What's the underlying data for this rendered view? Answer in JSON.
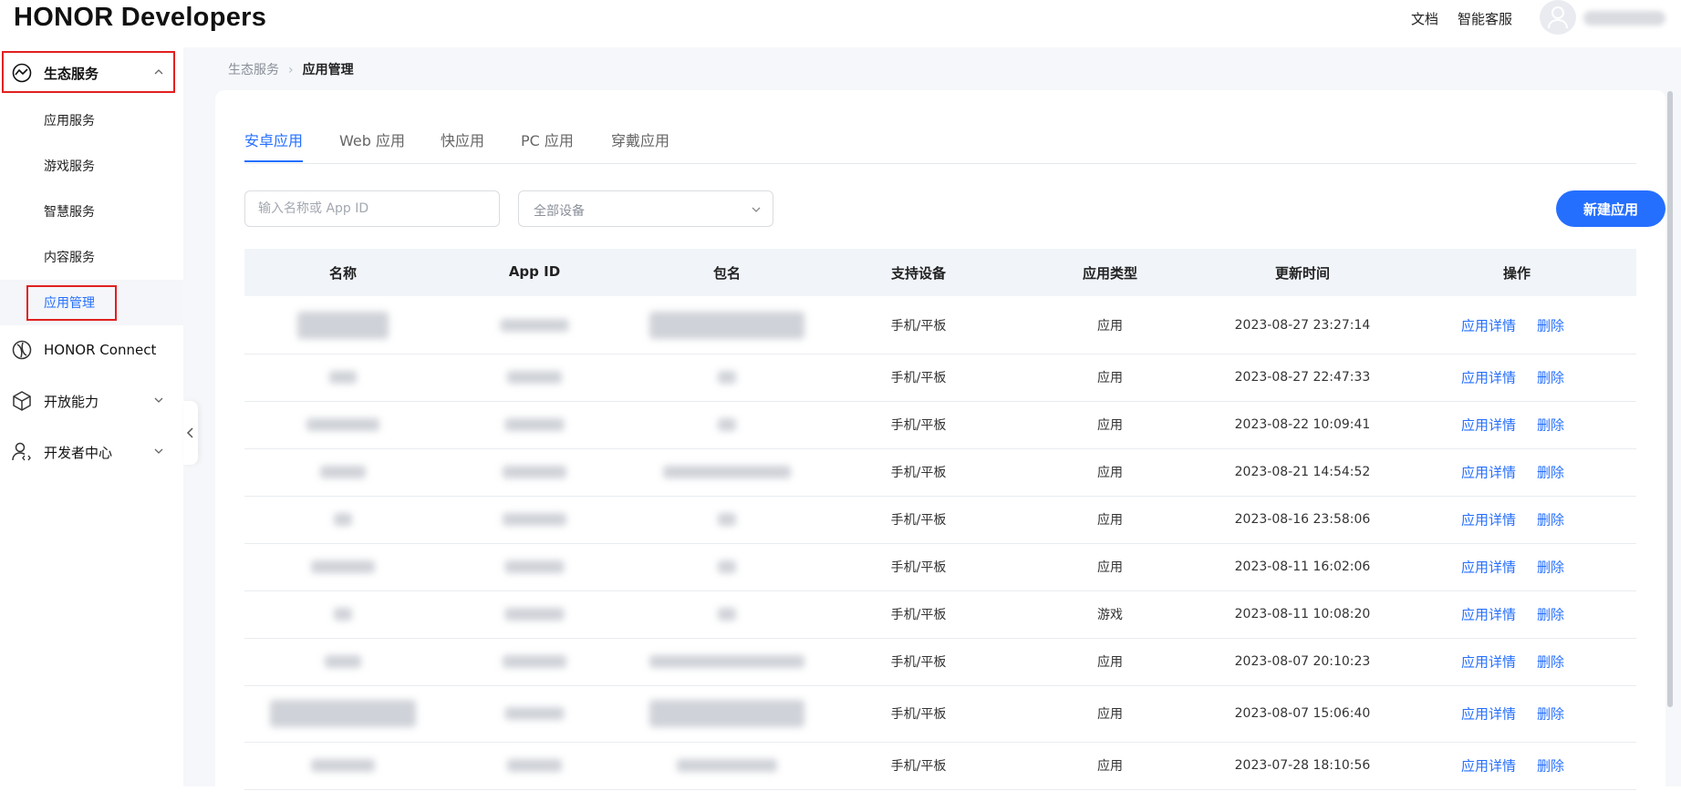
{
  "header": {
    "logo": "HONOR Developers",
    "docs": "文档",
    "support": "智能客服"
  },
  "sidebar": {
    "groups": [
      {
        "label": "生态服务",
        "icon": "ecosystem-icon",
        "expanded": true
      },
      {
        "label": "HONOR Connect",
        "icon": "connect-icon"
      },
      {
        "label": "开放能力",
        "icon": "cube-icon"
      },
      {
        "label": "开发者中心",
        "icon": "developer-icon"
      }
    ],
    "items": [
      {
        "label": "应用服务"
      },
      {
        "label": "游戏服务"
      },
      {
        "label": "智慧服务"
      },
      {
        "label": "内容服务"
      },
      {
        "label": "应用管理",
        "active": true
      }
    ]
  },
  "breadcrumb": {
    "parent": "生态服务",
    "separator": "›",
    "current": "应用管理"
  },
  "tabs": [
    {
      "label": "安卓应用",
      "active": true
    },
    {
      "label": "Web 应用"
    },
    {
      "label": "快应用"
    },
    {
      "label": "PC 应用"
    },
    {
      "label": "穿戴应用"
    }
  ],
  "filters": {
    "search_placeholder": "输入名称或 App ID",
    "device_select": "全部设备",
    "new_app": "新建应用"
  },
  "table": {
    "columns": [
      "名称",
      "App ID",
      "包名",
      "支持设备",
      "应用类型",
      "更新时间",
      "操作"
    ],
    "rows": [
      {
        "device": "手机/平板",
        "type": "应用",
        "updated": "2023-08-27 23:27:14",
        "detail": "应用详情",
        "delete": "删除"
      },
      {
        "device": "手机/平板",
        "type": "应用",
        "updated": "2023-08-27 22:47:33",
        "detail": "应用详情",
        "delete": "删除"
      },
      {
        "device": "手机/平板",
        "type": "应用",
        "updated": "2023-08-22 10:09:41",
        "detail": "应用详情",
        "delete": "删除"
      },
      {
        "device": "手机/平板",
        "type": "应用",
        "updated": "2023-08-21 14:54:52",
        "detail": "应用详情",
        "delete": "删除"
      },
      {
        "device": "手机/平板",
        "type": "应用",
        "updated": "2023-08-16 23:58:06",
        "detail": "应用详情",
        "delete": "删除"
      },
      {
        "device": "手机/平板",
        "type": "应用",
        "updated": "2023-08-11 16:02:06",
        "detail": "应用详情",
        "delete": "删除"
      },
      {
        "device": "手机/平板",
        "type": "游戏",
        "updated": "2023-08-11 10:08:20",
        "detail": "应用详情",
        "delete": "删除"
      },
      {
        "device": "手机/平板",
        "type": "应用",
        "updated": "2023-08-07 20:10:23",
        "detail": "应用详情",
        "delete": "删除"
      },
      {
        "device": "手机/平板",
        "type": "应用",
        "updated": "2023-08-07 15:06:40",
        "detail": "应用详情",
        "delete": "删除"
      },
      {
        "device": "手机/平板",
        "type": "应用",
        "updated": "2023-07-28 18:10:56",
        "detail": "应用详情",
        "delete": "删除"
      }
    ]
  },
  "colors": {
    "accent": "#256fff",
    "highlight_box": "#e1201f",
    "header_row_bg": "#f1f4f9"
  }
}
